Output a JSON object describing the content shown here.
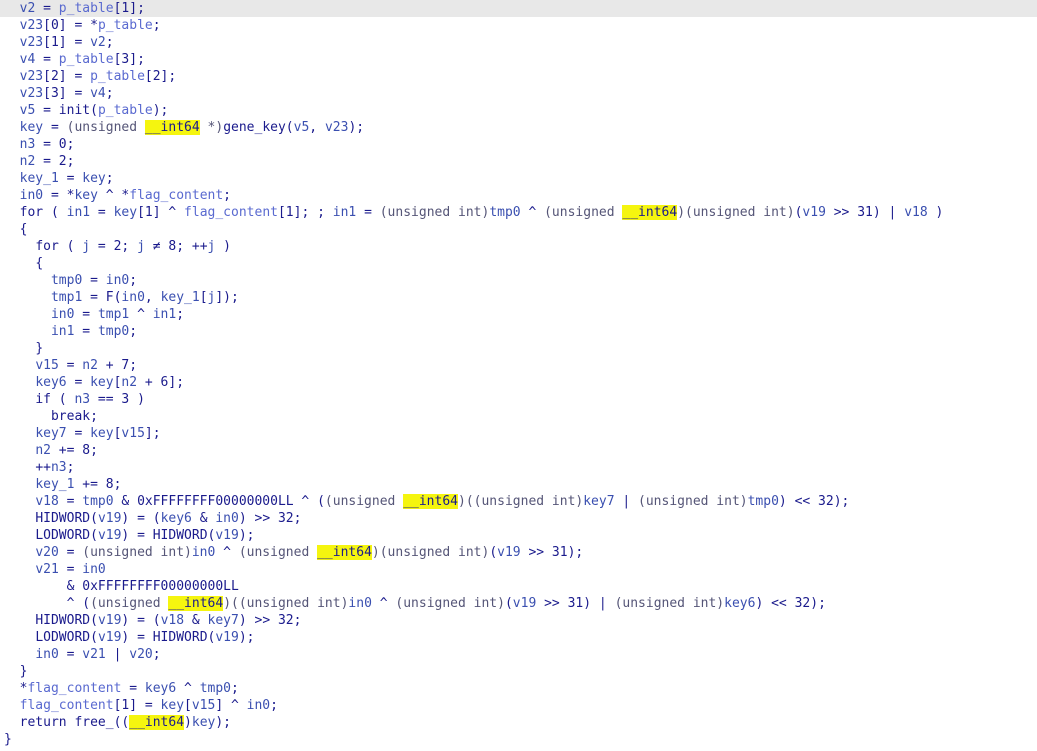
{
  "editor": {
    "title": "",
    "current_line_index": 0,
    "lines": [
      {
        "indent": 2,
        "tokens": [
          [
            "var",
            "v2"
          ],
          [
            "plain",
            " = "
          ],
          [
            "glob",
            "p_table"
          ],
          [
            "plain",
            "[1];"
          ]
        ]
      },
      {
        "indent": 2,
        "tokens": [
          [
            "var",
            "v23"
          ],
          [
            "plain",
            "[0] = *"
          ],
          [
            "glob",
            "p_table"
          ],
          [
            "plain",
            ";"
          ]
        ]
      },
      {
        "indent": 2,
        "tokens": [
          [
            "var",
            "v23"
          ],
          [
            "plain",
            "[1] = "
          ],
          [
            "var",
            "v2"
          ],
          [
            "plain",
            ";"
          ]
        ]
      },
      {
        "indent": 2,
        "tokens": [
          [
            "var",
            "v4"
          ],
          [
            "plain",
            " = "
          ],
          [
            "glob",
            "p_table"
          ],
          [
            "plain",
            "[3];"
          ]
        ]
      },
      {
        "indent": 2,
        "tokens": [
          [
            "var",
            "v23"
          ],
          [
            "plain",
            "[2] = "
          ],
          [
            "glob",
            "p_table"
          ],
          [
            "plain",
            "[2];"
          ]
        ]
      },
      {
        "indent": 2,
        "tokens": [
          [
            "var",
            "v23"
          ],
          [
            "plain",
            "[3] = "
          ],
          [
            "var",
            "v4"
          ],
          [
            "plain",
            ";"
          ]
        ]
      },
      {
        "indent": 2,
        "tokens": [
          [
            "var",
            "v5"
          ],
          [
            "plain",
            " = init("
          ],
          [
            "glob",
            "p_table"
          ],
          [
            "plain",
            ");"
          ]
        ]
      },
      {
        "indent": 2,
        "tokens": [
          [
            "var",
            "key"
          ],
          [
            "plain",
            " = "
          ],
          [
            "cast",
            "(unsigned "
          ],
          [
            "hl",
            "__int64"
          ],
          [
            "cast",
            " *)"
          ],
          [
            "plain",
            "gene_key("
          ],
          [
            "var",
            "v5"
          ],
          [
            "plain",
            ", "
          ],
          [
            "var",
            "v23"
          ],
          [
            "plain",
            ");"
          ]
        ]
      },
      {
        "indent": 2,
        "tokens": [
          [
            "var",
            "n3"
          ],
          [
            "plain",
            " = 0;"
          ]
        ]
      },
      {
        "indent": 2,
        "tokens": [
          [
            "var",
            "n2"
          ],
          [
            "plain",
            " = 2;"
          ]
        ]
      },
      {
        "indent": 2,
        "tokens": [
          [
            "var",
            "key_1"
          ],
          [
            "plain",
            " = "
          ],
          [
            "var",
            "key"
          ],
          [
            "plain",
            ";"
          ]
        ]
      },
      {
        "indent": 2,
        "tokens": [
          [
            "var",
            "in0"
          ],
          [
            "plain",
            " = *"
          ],
          [
            "var",
            "key"
          ],
          [
            "plain",
            " ^ *"
          ],
          [
            "glob",
            "flag_content"
          ],
          [
            "plain",
            ";"
          ]
        ]
      },
      {
        "indent": 2,
        "tokens": [
          [
            "kw",
            "for"
          ],
          [
            "plain",
            " ( "
          ],
          [
            "var",
            "in1"
          ],
          [
            "plain",
            " = "
          ],
          [
            "var",
            "key"
          ],
          [
            "plain",
            "[1] ^ "
          ],
          [
            "glob",
            "flag_content"
          ],
          [
            "plain",
            "[1]; ; "
          ],
          [
            "var",
            "in1"
          ],
          [
            "plain",
            " = "
          ],
          [
            "cast",
            "(unsigned int)"
          ],
          [
            "var",
            "tmp0"
          ],
          [
            "plain",
            " ^ "
          ],
          [
            "cast",
            "(unsigned "
          ],
          [
            "hl",
            "__int64"
          ],
          [
            "cast",
            ")(unsigned int)"
          ],
          [
            "plain",
            "("
          ],
          [
            "var",
            "v19"
          ],
          [
            "plain",
            " >> 31) | "
          ],
          [
            "var",
            "v18"
          ],
          [
            "plain",
            " )"
          ]
        ]
      },
      {
        "indent": 2,
        "tokens": [
          [
            "plain",
            "{"
          ]
        ]
      },
      {
        "indent": 4,
        "tokens": [
          [
            "kw",
            "for"
          ],
          [
            "plain",
            " ( "
          ],
          [
            "var",
            "j"
          ],
          [
            "plain",
            " = 2; "
          ],
          [
            "var",
            "j"
          ],
          [
            "plain",
            " ≠ 8; ++"
          ],
          [
            "var",
            "j"
          ],
          [
            "plain",
            " )"
          ]
        ]
      },
      {
        "indent": 4,
        "tokens": [
          [
            "plain",
            "{"
          ]
        ]
      },
      {
        "indent": 6,
        "tokens": [
          [
            "var",
            "tmp0"
          ],
          [
            "plain",
            " = "
          ],
          [
            "var",
            "in0"
          ],
          [
            "plain",
            ";"
          ]
        ]
      },
      {
        "indent": 6,
        "tokens": [
          [
            "var",
            "tmp1"
          ],
          [
            "plain",
            " = F("
          ],
          [
            "var",
            "in0"
          ],
          [
            "plain",
            ", "
          ],
          [
            "var",
            "key_1"
          ],
          [
            "plain",
            "["
          ],
          [
            "var",
            "j"
          ],
          [
            "plain",
            "]);"
          ]
        ]
      },
      {
        "indent": 6,
        "tokens": [
          [
            "var",
            "in0"
          ],
          [
            "plain",
            " = "
          ],
          [
            "var",
            "tmp1"
          ],
          [
            "plain",
            " ^ "
          ],
          [
            "var",
            "in1"
          ],
          [
            "plain",
            ";"
          ]
        ]
      },
      {
        "indent": 6,
        "tokens": [
          [
            "var",
            "in1"
          ],
          [
            "plain",
            " = "
          ],
          [
            "var",
            "tmp0"
          ],
          [
            "plain",
            ";"
          ]
        ]
      },
      {
        "indent": 4,
        "tokens": [
          [
            "plain",
            "}"
          ]
        ]
      },
      {
        "indent": 4,
        "tokens": [
          [
            "var",
            "v15"
          ],
          [
            "plain",
            " = "
          ],
          [
            "var",
            "n2"
          ],
          [
            "plain",
            " + 7;"
          ]
        ]
      },
      {
        "indent": 4,
        "tokens": [
          [
            "var",
            "key6"
          ],
          [
            "plain",
            " = "
          ],
          [
            "var",
            "key"
          ],
          [
            "plain",
            "["
          ],
          [
            "var",
            "n2"
          ],
          [
            "plain",
            " + 6];"
          ]
        ]
      },
      {
        "indent": 4,
        "tokens": [
          [
            "kw",
            "if"
          ],
          [
            "plain",
            " ( "
          ],
          [
            "var",
            "n3"
          ],
          [
            "plain",
            " == 3 )"
          ]
        ]
      },
      {
        "indent": 6,
        "tokens": [
          [
            "kw",
            "break"
          ],
          [
            "plain",
            ";"
          ]
        ]
      },
      {
        "indent": 4,
        "tokens": [
          [
            "var",
            "key7"
          ],
          [
            "plain",
            " = "
          ],
          [
            "var",
            "key"
          ],
          [
            "plain",
            "["
          ],
          [
            "var",
            "v15"
          ],
          [
            "plain",
            "];"
          ]
        ]
      },
      {
        "indent": 4,
        "tokens": [
          [
            "var",
            "n2"
          ],
          [
            "plain",
            " += 8;"
          ]
        ]
      },
      {
        "indent": 4,
        "tokens": [
          [
            "plain",
            "++"
          ],
          [
            "var",
            "n3"
          ],
          [
            "plain",
            ";"
          ]
        ]
      },
      {
        "indent": 4,
        "tokens": [
          [
            "var",
            "key_1"
          ],
          [
            "plain",
            " += 8;"
          ]
        ]
      },
      {
        "indent": 4,
        "tokens": [
          [
            "var",
            "v18"
          ],
          [
            "plain",
            " = "
          ],
          [
            "var",
            "tmp0"
          ],
          [
            "plain",
            " & 0xFFFFFFFF00000000LL ^ ("
          ],
          [
            "cast",
            "(unsigned "
          ],
          [
            "hl",
            "__int64"
          ],
          [
            "cast",
            ")((unsigned int)"
          ],
          [
            "var",
            "key7"
          ],
          [
            "plain",
            " | "
          ],
          [
            "cast",
            "(unsigned int)"
          ],
          [
            "var",
            "tmp0"
          ],
          [
            "plain",
            ") << 32);"
          ]
        ]
      },
      {
        "indent": 4,
        "tokens": [
          [
            "plain",
            "HIDWORD("
          ],
          [
            "var",
            "v19"
          ],
          [
            "plain",
            ") = ("
          ],
          [
            "var",
            "key6"
          ],
          [
            "plain",
            " & "
          ],
          [
            "var",
            "in0"
          ],
          [
            "plain",
            ") >> 32;"
          ]
        ]
      },
      {
        "indent": 4,
        "tokens": [
          [
            "plain",
            "LODWORD("
          ],
          [
            "var",
            "v19"
          ],
          [
            "plain",
            ") = HIDWORD("
          ],
          [
            "var",
            "v19"
          ],
          [
            "plain",
            ");"
          ]
        ]
      },
      {
        "indent": 4,
        "tokens": [
          [
            "var",
            "v20"
          ],
          [
            "plain",
            " = "
          ],
          [
            "cast",
            "(unsigned int)"
          ],
          [
            "var",
            "in0"
          ],
          [
            "plain",
            " ^ "
          ],
          [
            "cast",
            "(unsigned "
          ],
          [
            "hl",
            "__int64"
          ],
          [
            "cast",
            ")(unsigned int)"
          ],
          [
            "plain",
            "("
          ],
          [
            "var",
            "v19"
          ],
          [
            "plain",
            " >> 31);"
          ]
        ]
      },
      {
        "indent": 4,
        "tokens": [
          [
            "var",
            "v21"
          ],
          [
            "plain",
            " = "
          ],
          [
            "var",
            "in0"
          ]
        ]
      },
      {
        "indent": 8,
        "tokens": [
          [
            "plain",
            "& 0xFFFFFFFF00000000LL"
          ]
        ]
      },
      {
        "indent": 8,
        "tokens": [
          [
            "plain",
            "^ ("
          ],
          [
            "cast",
            "(unsigned "
          ],
          [
            "hl",
            "__int64"
          ],
          [
            "cast",
            ")((unsigned int)"
          ],
          [
            "var",
            "in0"
          ],
          [
            "plain",
            " ^ "
          ],
          [
            "cast",
            "(unsigned int)"
          ],
          [
            "plain",
            "("
          ],
          [
            "var",
            "v19"
          ],
          [
            "plain",
            " >> 31) | "
          ],
          [
            "cast",
            "(unsigned int)"
          ],
          [
            "var",
            "key6"
          ],
          [
            "plain",
            ") << 32);"
          ]
        ]
      },
      {
        "indent": 4,
        "tokens": [
          [
            "plain",
            "HIDWORD("
          ],
          [
            "var",
            "v19"
          ],
          [
            "plain",
            ") = ("
          ],
          [
            "var",
            "v18"
          ],
          [
            "plain",
            " & "
          ],
          [
            "var",
            "key7"
          ],
          [
            "plain",
            ") >> 32;"
          ]
        ]
      },
      {
        "indent": 4,
        "tokens": [
          [
            "plain",
            "LODWORD("
          ],
          [
            "var",
            "v19"
          ],
          [
            "plain",
            ") = HIDWORD("
          ],
          [
            "var",
            "v19"
          ],
          [
            "plain",
            ");"
          ]
        ]
      },
      {
        "indent": 4,
        "tokens": [
          [
            "var",
            "in0"
          ],
          [
            "plain",
            " = "
          ],
          [
            "var",
            "v21"
          ],
          [
            "plain",
            " | "
          ],
          [
            "var",
            "v20"
          ],
          [
            "plain",
            ";"
          ]
        ]
      },
      {
        "indent": 2,
        "tokens": [
          [
            "plain",
            "}"
          ]
        ]
      },
      {
        "indent": 2,
        "tokens": [
          [
            "plain",
            "*"
          ],
          [
            "glob",
            "flag_content"
          ],
          [
            "plain",
            " = "
          ],
          [
            "var",
            "key6"
          ],
          [
            "plain",
            " ^ "
          ],
          [
            "var",
            "tmp0"
          ],
          [
            "plain",
            ";"
          ]
        ]
      },
      {
        "indent": 2,
        "tokens": [
          [
            "glob",
            "flag_content"
          ],
          [
            "plain",
            "[1] = "
          ],
          [
            "var",
            "key"
          ],
          [
            "plain",
            "["
          ],
          [
            "var",
            "v15"
          ],
          [
            "plain",
            "] ^ "
          ],
          [
            "var",
            "in0"
          ],
          [
            "plain",
            ";"
          ]
        ]
      },
      {
        "indent": 2,
        "tokens": [
          [
            "kw",
            "return"
          ],
          [
            "plain",
            " free_(("
          ],
          [
            "hl",
            "__int64"
          ],
          [
            "plain",
            ")"
          ],
          [
            "var",
            "key"
          ],
          [
            "plain",
            ");"
          ]
        ]
      },
      {
        "indent": 0,
        "tokens": [
          [
            "plain",
            "}"
          ]
        ]
      }
    ]
  },
  "colors": {
    "text": "#1a1a8c",
    "variable": "#3a4fb0",
    "highlight": "#f5f50f",
    "current_line": "#e8e8e8",
    "background": "#ffffff"
  }
}
